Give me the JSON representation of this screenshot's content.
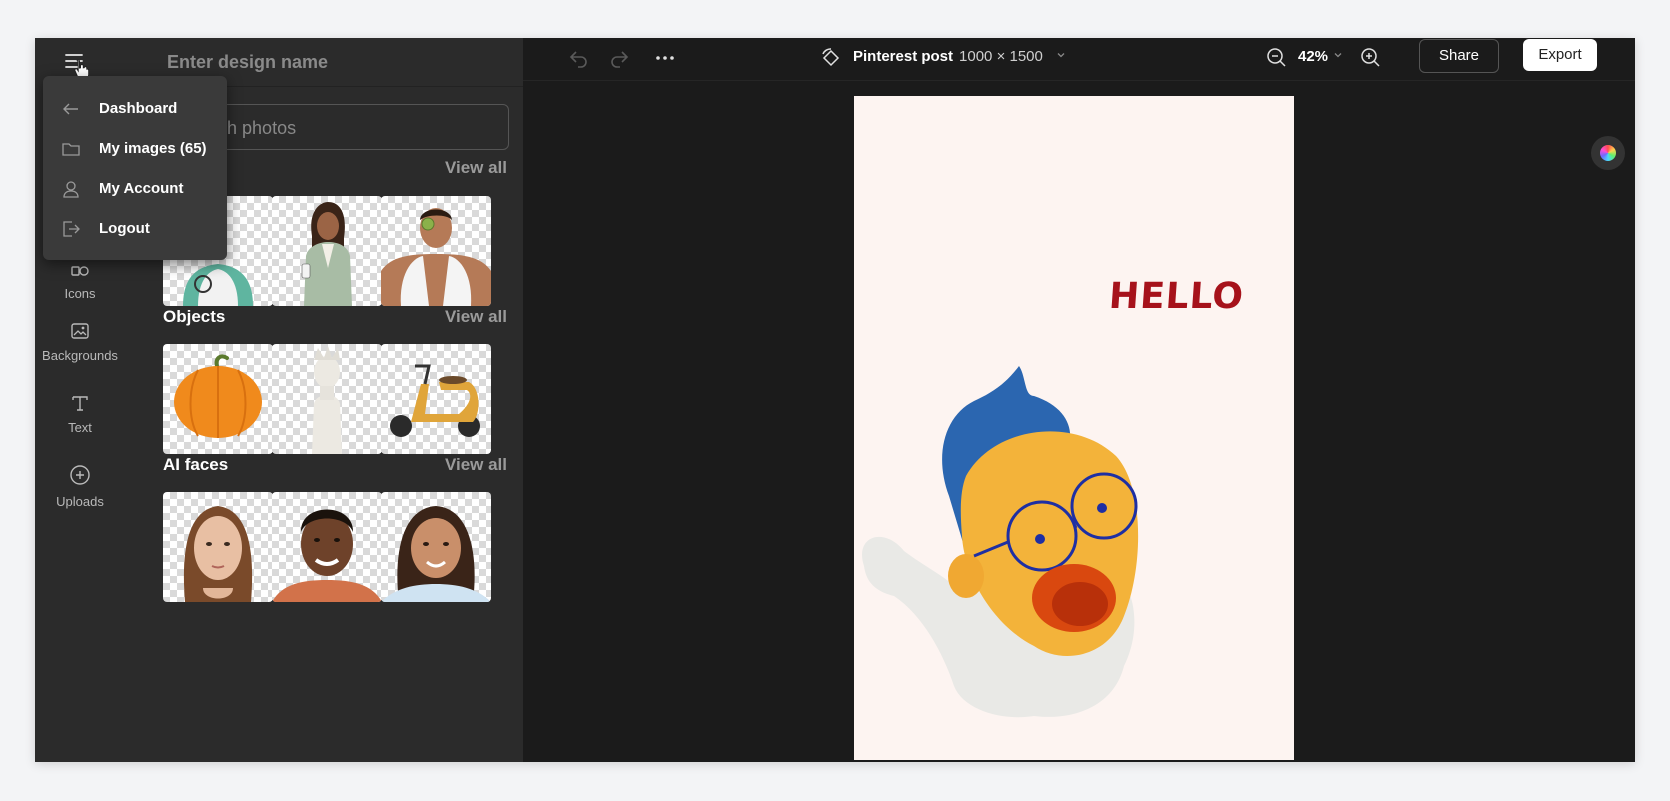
{
  "header": {
    "design_name_placeholder": "Enter design name"
  },
  "rail": {
    "items": [
      {
        "label": "Icons",
        "icon": "icons-icon"
      },
      {
        "label": "Backgrounds",
        "icon": "image-icon"
      },
      {
        "label": "Text",
        "icon": "text-icon"
      },
      {
        "label": "Uploads",
        "icon": "plus-circle-icon"
      }
    ]
  },
  "search": {
    "placeholder": "Search photos",
    "visible_text": "otos"
  },
  "dropdown": {
    "items": [
      {
        "label": "Dashboard",
        "icon": "arrow-left-icon"
      },
      {
        "label": "My images (65)",
        "icon": "folder-icon"
      },
      {
        "label": "My Account",
        "icon": "user-icon"
      },
      {
        "label": "Logout",
        "icon": "logout-icon"
      }
    ]
  },
  "sections": [
    {
      "title": "",
      "view_all": "View all"
    },
    {
      "title": "Objects",
      "view_all": "View all"
    },
    {
      "title": "AI faces",
      "view_all": "View all"
    }
  ],
  "toolbar": {
    "format_name": "Pinterest post",
    "format_dims": "1000 × 1500",
    "zoom": "42%",
    "share_label": "Share",
    "export_label": "Export"
  },
  "canvas": {
    "text": "HELLO",
    "background": "#fdf4f1",
    "text_color": "#a6121b"
  }
}
